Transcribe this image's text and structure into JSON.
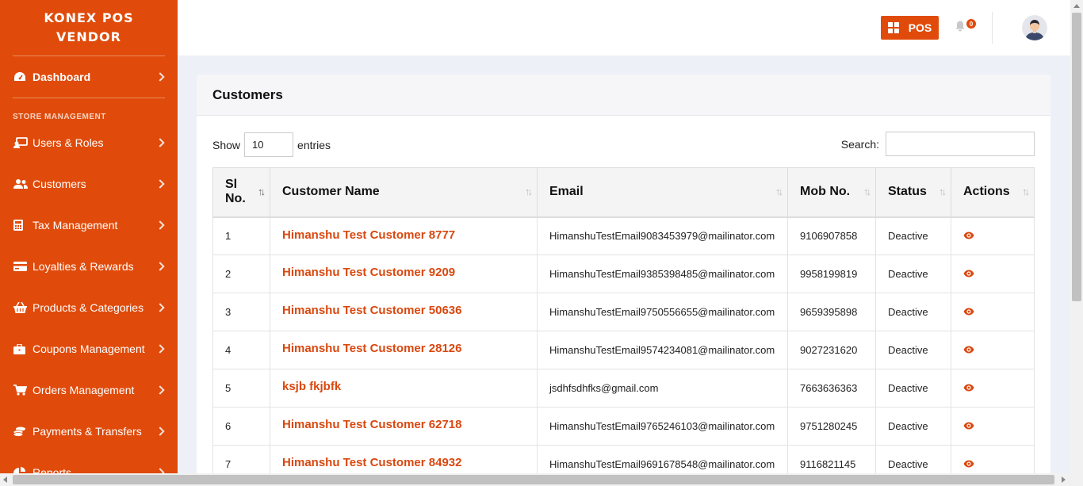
{
  "brand": {
    "line1": "KONEX POS",
    "line2": "VENDOR"
  },
  "sidebar": {
    "dashboard": "Dashboard",
    "section": "STORE MANAGEMENT",
    "items": [
      {
        "label": "Users & Roles",
        "icon": "users-roles-icon"
      },
      {
        "label": "Customers",
        "icon": "customers-icon"
      },
      {
        "label": "Tax Management",
        "icon": "calculator-icon"
      },
      {
        "label": "Loyalties & Rewards",
        "icon": "credit-card-icon"
      },
      {
        "label": "Products & Categories",
        "icon": "basket-icon"
      },
      {
        "label": "Coupons Management",
        "icon": "briefcase-icon"
      },
      {
        "label": "Orders Management",
        "icon": "cart-icon"
      },
      {
        "label": "Payments & Transfers",
        "icon": "coins-icon"
      },
      {
        "label": "Reports",
        "icon": "chart-icon"
      }
    ]
  },
  "header": {
    "pos_label": "POS",
    "notification_count": "0"
  },
  "page": {
    "title": "Customers",
    "show_label": "Show",
    "entries_value": "10",
    "entries_label": "entries",
    "search_label": "Search:",
    "search_value": ""
  },
  "table": {
    "columns": [
      "Sl No.",
      "Customer Name",
      "Email",
      "Mob No.",
      "Status",
      "Actions"
    ],
    "col_sl_line1": "Sl",
    "col_sl_line2": "No.",
    "rows": [
      {
        "sl": "1",
        "name": "Himanshu Test Customer 8777",
        "email": "HimanshuTestEmail9083453979@mailinator.com",
        "mob": "9106907858",
        "status": "Deactive"
      },
      {
        "sl": "2",
        "name": "Himanshu Test Customer 9209",
        "email": "HimanshuTestEmail9385398485@mailinator.com",
        "mob": "9958199819",
        "status": "Deactive"
      },
      {
        "sl": "3",
        "name": "Himanshu Test Customer 50636",
        "email": "HimanshuTestEmail9750556655@mailinator.com",
        "mob": "9659395898",
        "status": "Deactive"
      },
      {
        "sl": "4",
        "name": "Himanshu Test Customer 28126",
        "email": "HimanshuTestEmail9574234081@mailinator.com",
        "mob": "9027231620",
        "status": "Deactive"
      },
      {
        "sl": "5",
        "name": "ksjb fkjbfk",
        "email": "jsdhfsdhfks@gmail.com",
        "mob": "7663636363",
        "status": "Deactive"
      },
      {
        "sl": "6",
        "name": "Himanshu Test Customer 62718",
        "email": "HimanshuTestEmail9765246103@mailinator.com",
        "mob": "9751280245",
        "status": "Deactive"
      },
      {
        "sl": "7",
        "name": "Himanshu Test Customer 84932",
        "email": "HimanshuTestEmail9691678548@mailinator.com",
        "mob": "9116821145",
        "status": "Deactive"
      }
    ]
  },
  "colors": {
    "accent": "#e04b0b",
    "link": "#d9480f"
  }
}
